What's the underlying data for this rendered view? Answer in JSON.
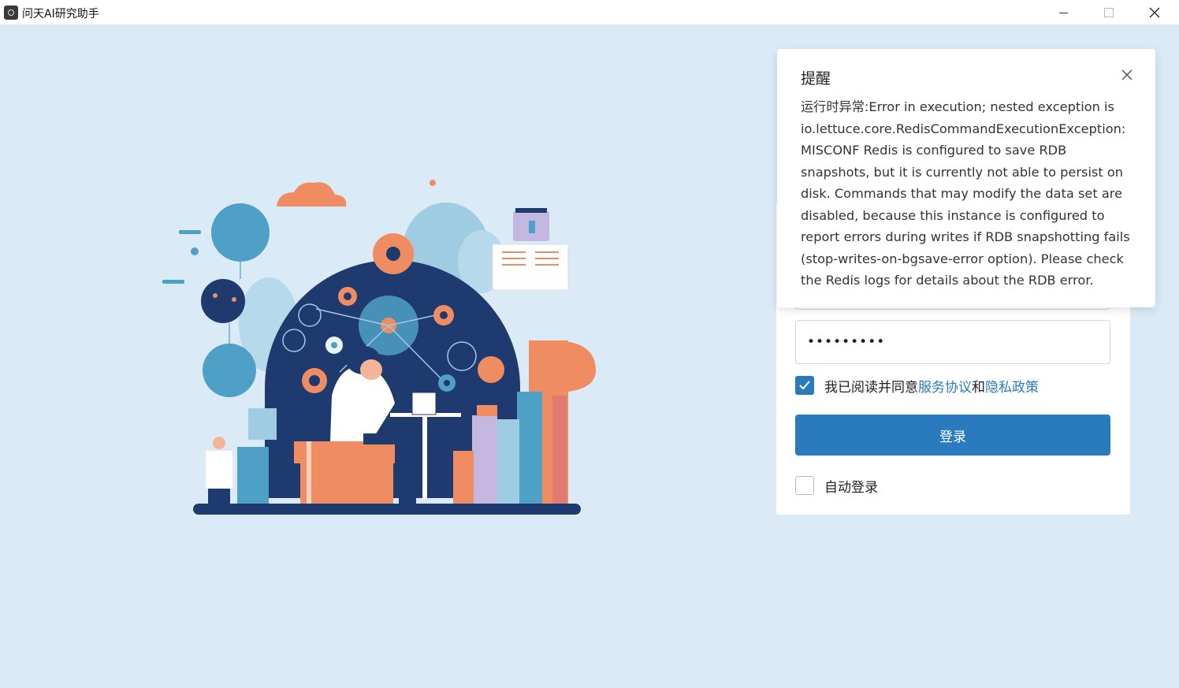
{
  "window": {
    "title": "问天AI研究助手",
    "minimize_icon": "minimize-icon",
    "maximize_icon": "maximize-icon",
    "close_icon": "close-icon"
  },
  "notification": {
    "title": "提醒",
    "message": "运行时异常:Error in execution; nested exception is io.lettuce.core.RedisCommandExecutionException: MISCONF Redis is configured to save RDB snapshots, but it is currently not able to persist on disk. Commands that may modify the data set are disabled, because this instance is configured to report errors during writes if RDB snapshotting fails (stop-writes-on-bgsave-error option). Please check the Redis logs for details about the RDB error.",
    "close_icon": "close-icon"
  },
  "login": {
    "password_value": "•••••••••",
    "agree_checked": true,
    "agree_prefix": "我已阅读并同意",
    "service_link": "服务协议",
    "agree_and": "和",
    "privacy_link": "隐私政策",
    "login_button": "登录",
    "auto_login_checked": false,
    "auto_login_label": "自动登录"
  },
  "colors": {
    "accent": "#2a7bbd",
    "background": "#dbeaf7",
    "navy": "#1f3a6e",
    "orange": "#f08c62"
  }
}
